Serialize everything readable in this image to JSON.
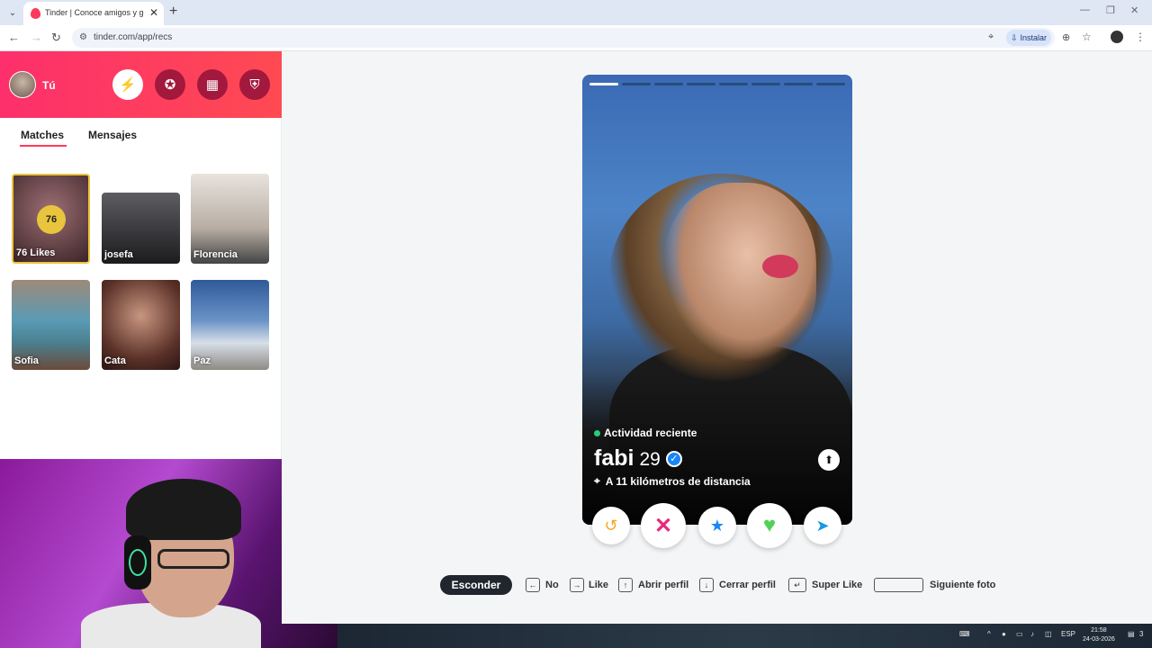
{
  "browser": {
    "tab_title": "Tinder | Conoce amigos y gente",
    "url": "tinder.com/app/recs",
    "install_label": "Instalar"
  },
  "sidebar": {
    "user_name": "Tú",
    "tabs": [
      "Matches",
      "Mensajes"
    ],
    "likes": {
      "count": "76",
      "label": "76 Likes"
    },
    "matches": [
      {
        "name": "josefa"
      },
      {
        "name": "Florencia"
      },
      {
        "name": "Sofia"
      },
      {
        "name": "Cata"
      },
      {
        "name": "Paz"
      }
    ]
  },
  "profile": {
    "activity": "Actividad reciente",
    "name": "fabi",
    "age": "29",
    "distance": "A 11 kilómetros de distancia",
    "photo_count": 8,
    "current_photo": 1
  },
  "shortcuts": {
    "hide": "Esconder",
    "items": [
      "No",
      "Like",
      "Abrir perfil",
      "Cerrar perfil",
      "Super Like",
      "Siguiente foto"
    ]
  },
  "taskbar": {
    "lang": "ESP",
    "time": "21:58",
    "date": "24-03-2026",
    "notifications": "3"
  },
  "colors": {
    "brand_start": "#fd2f6c",
    "brand_end": "#fe4a52",
    "like_green": "#52d157",
    "nope_pink": "#e8287a",
    "super_blue": "#1786f8",
    "boost_blue": "#1a98e6",
    "rewind_yellow": "#f5a623"
  }
}
